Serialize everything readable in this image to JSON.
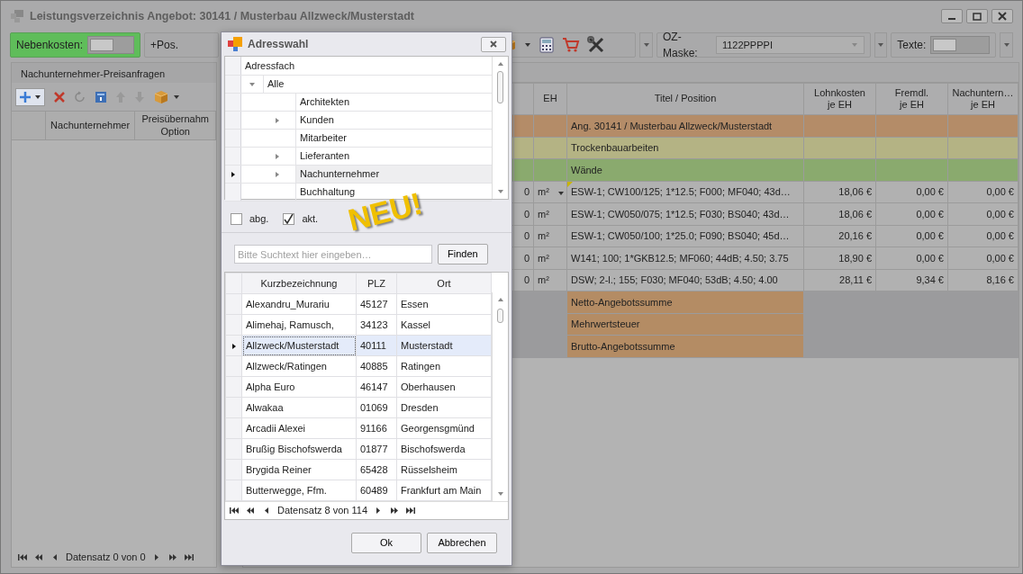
{
  "window": {
    "title": "Leistungsverzeichnis Angebot: 30141 / Musterbau Allzweck/Musterstadt"
  },
  "toolbar": {
    "nebenkosten": {
      "label": "Nebenkosten:",
      "on": false
    },
    "add_position": {
      "label": "+Pos."
    },
    "oz_mask": {
      "label": "OZ-Maske:",
      "value": "1122PPPPI"
    },
    "texte": {
      "label": "Texte:",
      "on": false
    }
  },
  "left_panel": {
    "tab": "Nachunternehmer-Preisanfragen",
    "columns": [
      "Nachunternehmer",
      "Preisübernahm\nOption"
    ],
    "navigator": "Datensatz 0 von 0"
  },
  "grid": {
    "columns": [
      "EH",
      "Titel / Position",
      "Lohnkosten\nje EH",
      "Fremdl.\nje EH",
      "Nachuntern…\nje EH"
    ],
    "rows": [
      {
        "kind": "title",
        "color": "#b48c68",
        "text": "Ang. 30141 / Musterbau Allzweck/Musterstadt"
      },
      {
        "kind": "title",
        "color": "#b4b384",
        "text": "Trockenbauarbeiten"
      },
      {
        "kind": "title",
        "color": "#8aaa6e",
        "text": "Wände"
      },
      {
        "kind": "position",
        "focused": true,
        "quantity": "0",
        "unit": "m²",
        "text": "ESW-1; CW100/125; 1*12.5; F000; MF040; 43d…",
        "labor": "18,06 €",
        "external": "0,00 €",
        "subcontract": "0,00 €"
      },
      {
        "kind": "position",
        "focused": false,
        "quantity": "0",
        "unit": "m²",
        "text": "ESW-1; CW050/075; 1*12.5; F030; BS040; 43d…",
        "labor": "18,06 €",
        "external": "0,00 €",
        "subcontract": "0,00 €"
      },
      {
        "kind": "position",
        "focused": false,
        "quantity": "0",
        "unit": "m²",
        "text": "ESW-1; CW050/100; 1*25.0; F090; BS040; 45d…",
        "labor": "20,16 €",
        "external": "0,00 €",
        "subcontract": "0,00 €"
      },
      {
        "kind": "position",
        "focused": false,
        "quantity": "0",
        "unit": "m²",
        "text": "W141; 100; 1*GKB12.5; MF060; 44dB; 4.50; 3.75",
        "labor": "18,90 €",
        "external": "0,00 €",
        "subcontract": "0,00 €"
      },
      {
        "kind": "position",
        "focused": false,
        "quantity": "0",
        "unit": "m²",
        "text": "DSW; 2-l.; 155; F030; MF040; 53dB; 4.50; 4.00",
        "labor": "28,11 €",
        "external": "9,34 €",
        "subcontract": "8,16 €"
      }
    ],
    "summary": [
      "Netto-Angebotssumme",
      "Mehrwertsteuer",
      "Brutto-Angebotssumme"
    ]
  },
  "dialog": {
    "title": "Adresswahl",
    "tree_header": "Adressfach",
    "tree": [
      {
        "label": "Alle",
        "expanded": true,
        "selected": false,
        "children": [
          {
            "label": "Architekten",
            "expandable": false,
            "selected": false
          },
          {
            "label": "Kunden",
            "expandable": true,
            "selected": false
          },
          {
            "label": "Mitarbeiter",
            "expandable": false,
            "selected": false
          },
          {
            "label": "Lieferanten",
            "expandable": true,
            "selected": false
          },
          {
            "label": "Nachunternehmer",
            "expandable": true,
            "selected": true
          },
          {
            "label": "Buchhaltung",
            "expandable": false,
            "selected": false
          }
        ]
      }
    ],
    "filters": [
      {
        "label": "abg.",
        "checked": false
      },
      {
        "label": "akt.",
        "checked": true
      }
    ],
    "badge": "NEU!",
    "search": {
      "placeholder": "Bitte Suchtext hier eingeben…",
      "button": "Finden"
    },
    "columns": [
      "Kurzbezeichnung",
      "PLZ",
      "Ort"
    ],
    "rows": [
      {
        "name": "Alexandru_Murariu",
        "zip": "45127",
        "city": "Essen",
        "selected": false
      },
      {
        "name": "Alimehaj, Ramusch,",
        "zip": "34123",
        "city": "Kassel",
        "selected": false
      },
      {
        "name": "Allzweck/Musterstadt",
        "zip": "40111",
        "city": "Musterstadt",
        "selected": true
      },
      {
        "name": "Allzweck/Ratingen",
        "zip": "40885",
        "city": "Ratingen",
        "selected": false
      },
      {
        "name": "Alpha Euro",
        "zip": "46147",
        "city": "Oberhausen",
        "selected": false
      },
      {
        "name": "Alwakaa",
        "zip": "01069",
        "city": "Dresden",
        "selected": false
      },
      {
        "name": "Arcadii Alexei",
        "zip": "91166",
        "city": "Georgensgmünd",
        "selected": false
      },
      {
        "name": "Brußig Bischofswerda",
        "zip": "01877",
        "city": "Bischofswerda",
        "selected": false
      },
      {
        "name": "Brygida Reiner",
        "zip": "65428",
        "city": "Rüsselsheim",
        "selected": false
      },
      {
        "name": "Butterwegge, Ffm.",
        "zip": "60489",
        "city": "Frankfurt am Main",
        "selected": false
      }
    ],
    "navigator": "Datensatz 8 von 114",
    "buttons": [
      "Ok",
      "Abbrechen"
    ]
  }
}
